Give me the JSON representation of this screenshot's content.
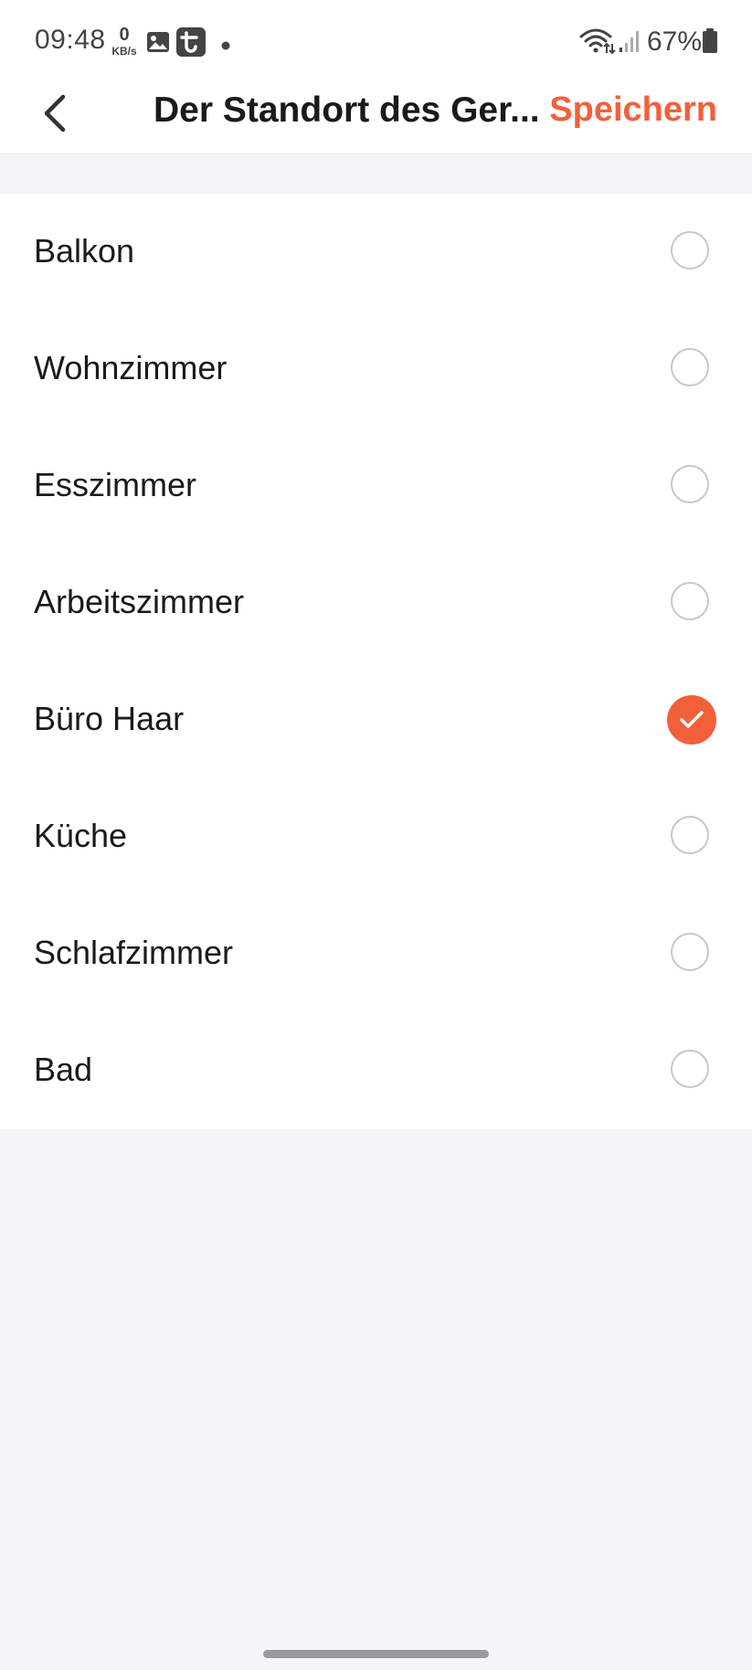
{
  "status_bar": {
    "time": "09:48",
    "network_speed_value": "0",
    "network_speed_unit": "KB/s",
    "battery_percent": "67%",
    "icons": [
      "gallery-icon",
      "tuya-app-icon",
      "notification-dot-icon",
      "wifi-icon",
      "signal-icon",
      "battery-icon"
    ]
  },
  "header": {
    "title": "Der Standort des Ger...",
    "save_label": "Speichern",
    "accent_color": "#f2603a"
  },
  "rooms": [
    {
      "label": "Balkon",
      "selected": false
    },
    {
      "label": "Wohnzimmer",
      "selected": false
    },
    {
      "label": "Esszimmer",
      "selected": false
    },
    {
      "label": "Arbeitszimmer",
      "selected": false
    },
    {
      "label": "Büro Haar",
      "selected": true
    },
    {
      "label": "Küche",
      "selected": false
    },
    {
      "label": "Schlafzimmer",
      "selected": false
    },
    {
      "label": "Bad",
      "selected": false
    }
  ]
}
